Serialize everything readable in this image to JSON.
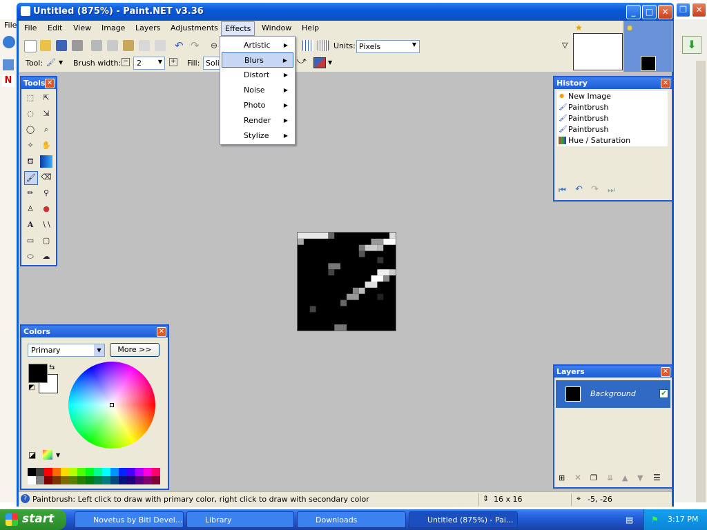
{
  "window": {
    "title": "Untitled (875%) - Paint.NET v3.36"
  },
  "bg_app": {
    "menu_partial": "File",
    "side_logo": "N"
  },
  "menubar": [
    "File",
    "Edit",
    "View",
    "Image",
    "Layers",
    "Adjustments",
    "Effects",
    "Window",
    "Help"
  ],
  "toolbar": {
    "units_label": "Units:",
    "units_value": "Pixels",
    "tool_label": "Tool:",
    "brush_width_label": "Brush width:",
    "brush_width_value": "2",
    "fill_label": "Fill:",
    "fill_value": "Solid"
  },
  "effects_menu": [
    "Artistic",
    "Blurs",
    "Distort",
    "Noise",
    "Photo",
    "Render",
    "Stylize"
  ],
  "tools_panel": {
    "title": "Tools",
    "items": [
      "rectangle-select",
      "move-selection",
      "lasso-select",
      "move-selected",
      "ellipse-select",
      "zoom",
      "magic-wand",
      "pan",
      "paint-bucket",
      "gradient",
      "paintbrush",
      "eraser",
      "pencil",
      "color-picker",
      "clone-stamp",
      "recolor",
      "text",
      "line-curve",
      "rectangle",
      "rounded-rectangle",
      "ellipse",
      "freeform-shape"
    ]
  },
  "history_panel": {
    "title": "History",
    "items": [
      "New Image",
      "Paintbrush",
      "Paintbrush",
      "Paintbrush",
      "Hue / Saturation"
    ]
  },
  "colors_panel": {
    "title": "Colors",
    "mode": "Primary",
    "more_button": "More >>",
    "primary_color": "#000000",
    "secondary_color": "#ffffff"
  },
  "layers_panel": {
    "title": "Layers",
    "layer_name": "Background",
    "visible": true
  },
  "statusbar": {
    "hint": "Paintbrush: Left click to draw with primary color, right click to draw with secondary color",
    "size": "16 x 16",
    "coords": "-5, -26"
  },
  "taskbar": {
    "start": "start",
    "tasks": [
      "Novetus by Bitl Devel...",
      "Library",
      "Downloads",
      "Untitled (875%) - Pai..."
    ],
    "clock": "3:17 PM"
  },
  "colors": {
    "accent": "#1f57d6",
    "canvas_bg": "#c0c0c0",
    "menu_highlight": "#c6d6f3"
  }
}
